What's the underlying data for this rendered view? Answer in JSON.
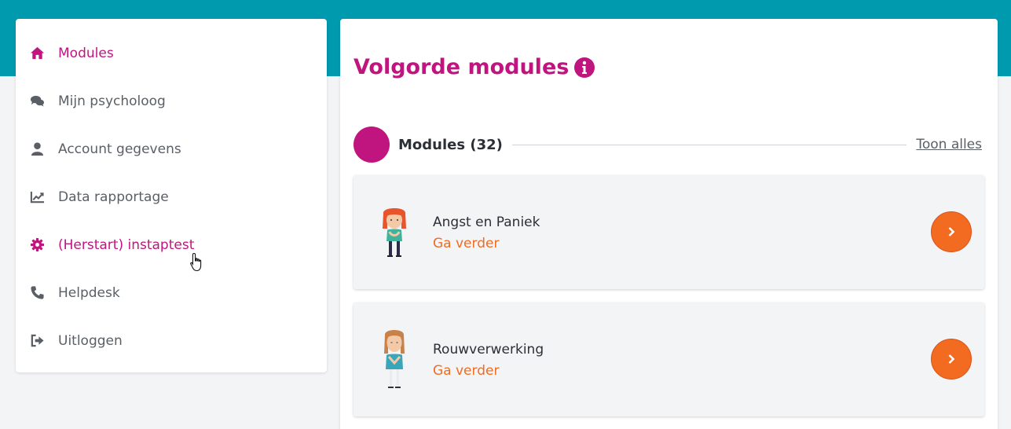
{
  "sidebar": {
    "items": [
      {
        "label": "Modules",
        "icon": "home-icon",
        "active": true
      },
      {
        "label": "Mijn psycholoog",
        "icon": "chat-icon",
        "active": false
      },
      {
        "label": "Account gegevens",
        "icon": "user-icon",
        "active": false
      },
      {
        "label": "Data rapportage",
        "icon": "chart-line-icon",
        "active": false
      },
      {
        "label": "(Herstart) instaptest",
        "icon": "gear-icon",
        "active": true
      },
      {
        "label": "Helpdesk",
        "icon": "phone-icon",
        "active": false
      },
      {
        "label": "Uitloggen",
        "icon": "sign-out-icon",
        "active": false
      }
    ]
  },
  "main": {
    "title": "Volgorde modules",
    "modules_heading": "Modules (32)",
    "show_all": "Toon alles",
    "cards": [
      {
        "title": "Angst en Paniek",
        "action": "Ga verder",
        "avatar": "woman-red-hair-avatar"
      },
      {
        "title": "Rouwverwerking",
        "action": "Ga verder",
        "avatar": "woman-brown-hair-avatar"
      }
    ]
  },
  "colors": {
    "accent": "#c0157f",
    "topband": "#009aae",
    "orange": "#f26b21",
    "text": "#5a5f66"
  }
}
